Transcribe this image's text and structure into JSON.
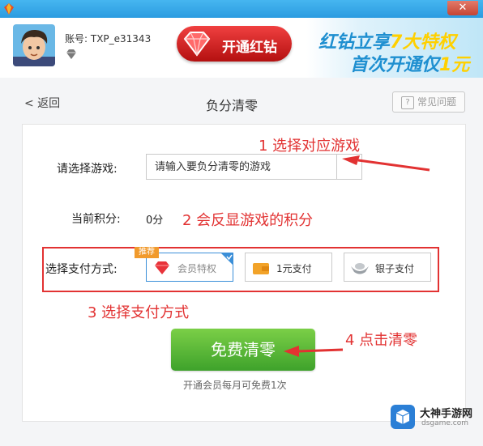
{
  "titlebar": {
    "close_label": "✕"
  },
  "header": {
    "account_text": "账号: TXP_e31343",
    "vip_button_label": "开通红钻",
    "banner_line1_pre": "红钻立享",
    "banner_line1_hl": "7大特权",
    "banner_line2_pre": "首次开通仅",
    "banner_line2_hl": "1元"
  },
  "nav": {
    "back_label": "< 返回",
    "page_title": "负分清零",
    "help_label": "常见问题"
  },
  "form": {
    "game_label": "请选择游戏:",
    "game_placeholder": "请输入要负分清零的游戏",
    "score_label": "当前积分:",
    "score_value": "0分",
    "pay_label": "选择支付方式:",
    "recommend_badge": "推荐",
    "pay_options": [
      {
        "label": "会员特权",
        "icon": "red-gem-icon"
      },
      {
        "label": "1元支付",
        "icon": "wallet-icon"
      },
      {
        "label": "银子支付",
        "icon": "silver-ingot-icon"
      }
    ],
    "submit_label": "免费清零",
    "note": "开通会员每月可免费1次"
  },
  "annotations": {
    "a1": "1 选择对应游戏",
    "a2": "2 会反显游戏的积分",
    "a3": "3 选择支付方式",
    "a4": "4 点击清零"
  },
  "watermark": {
    "text": "大神手游网",
    "url": "dsgame.com"
  },
  "colors": {
    "accent_red": "#e23232",
    "button_green": "#4bb233",
    "title_blue": "#2b9be0"
  }
}
